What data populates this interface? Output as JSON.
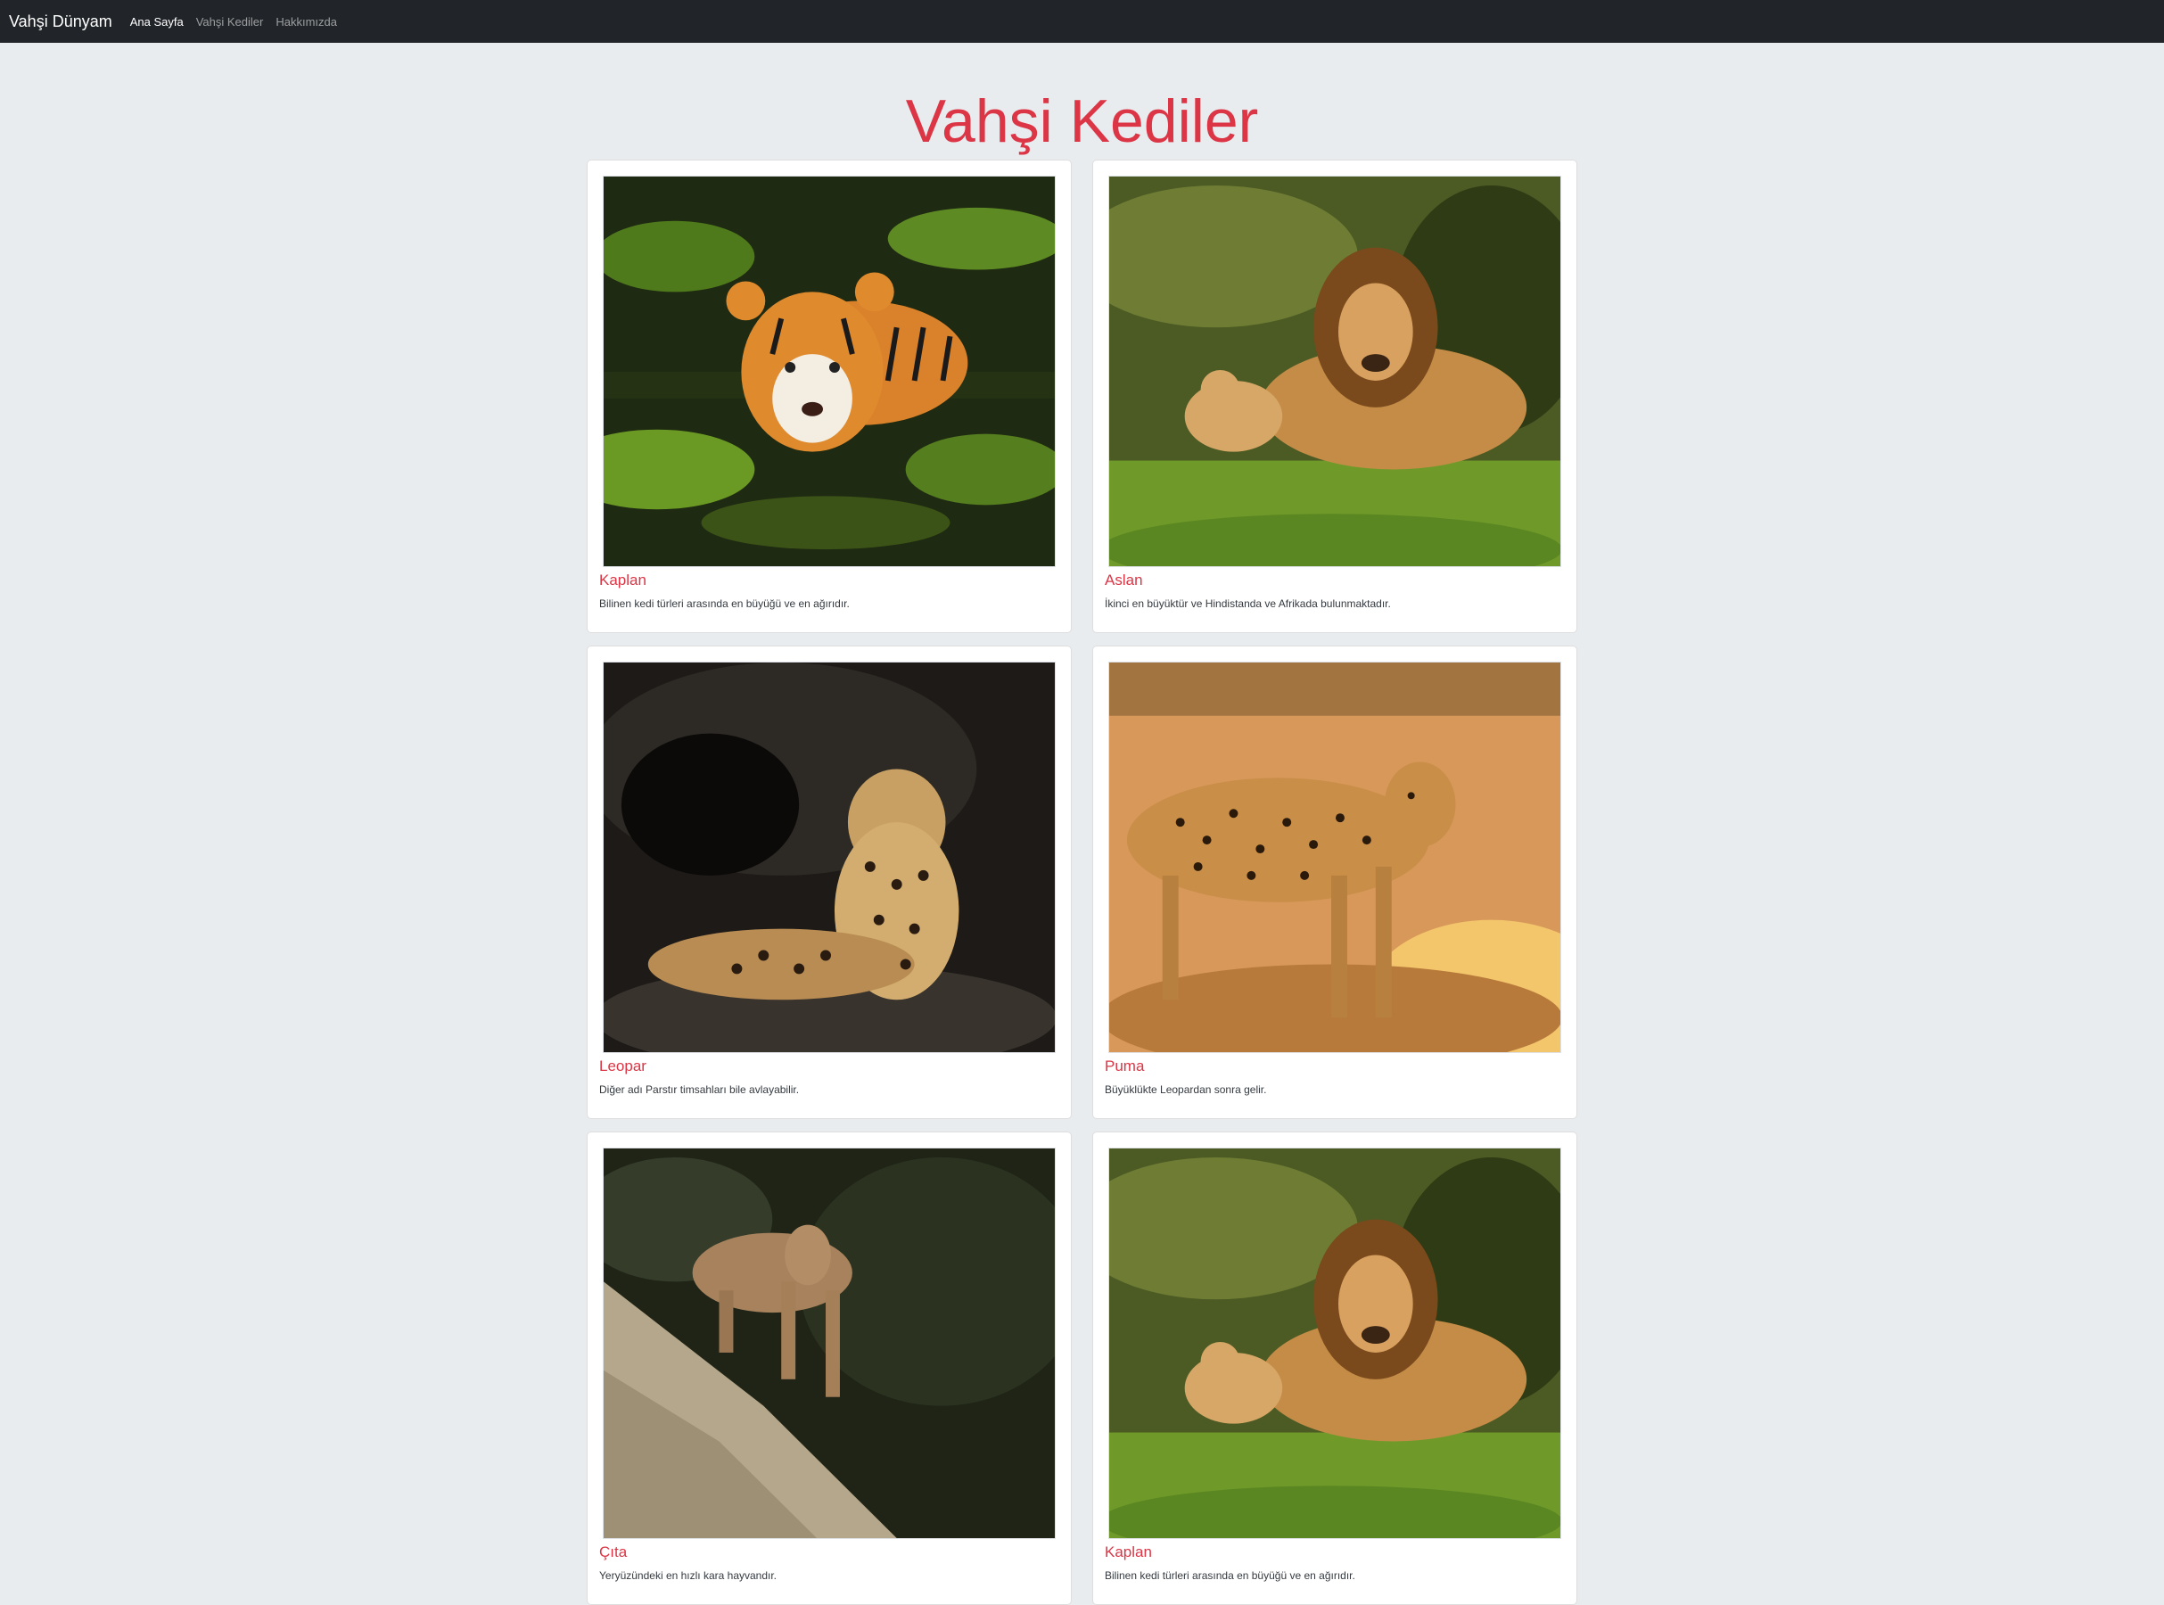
{
  "navbar": {
    "brand": "Vahşi Dünyam",
    "links": [
      "Ana Sayfa",
      "Vahşi Kediler",
      "Hakkımızda"
    ]
  },
  "page": {
    "title": "Vahşi Kediler"
  },
  "cards": [
    {
      "name": "Kaplan",
      "desc": "Bilinen kedi türleri arasında en büyüğü ve en ağırıdır.",
      "image": "tiger-swimming-image"
    },
    {
      "name": "Aslan",
      "desc": "İkinci en büyüktür ve Hindistanda ve Afrikada bulunmaktadır.",
      "image": "lion-and-cub-image"
    },
    {
      "name": "Leopar",
      "desc": "Diğer adı Parstır timsahları bile avlayabilir.",
      "image": "leopard-resting-image"
    },
    {
      "name": "Puma",
      "desc": "Büyüklükte Leopardan sonra gelir.",
      "image": "cheetah-walking-image"
    },
    {
      "name": "Çıta",
      "desc": "Yeryüzündeki en hızlı kara hayvandır.",
      "image": "puma-on-rock-image"
    },
    {
      "name": "Kaplan",
      "desc": "Bilinen kedi türleri arasında en büyüğü ve en ağırıdır.",
      "image": "lion-and-cub-image"
    }
  ]
}
